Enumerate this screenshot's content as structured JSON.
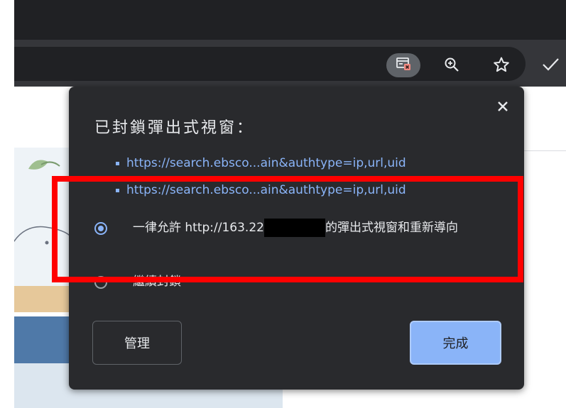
{
  "dialog": {
    "title": "已封鎖彈出式視窗：",
    "blocked_links": [
      "https://search.ebsco...ain&authtype=ip,url,uid",
      "https://search.ebsco...ain&authtype=ip,url,uid"
    ],
    "options": [
      {
        "label_prefix": "一律允許 http://163.22",
        "label_suffix": "的彈出式視窗和重新導向",
        "selected": true
      },
      {
        "label": "繼續封鎖",
        "selected": false
      }
    ],
    "manage_label": "管理",
    "done_label": "完成"
  },
  "colors": {
    "accent": "#8ab4f8",
    "dialog_bg": "#292a2d",
    "highlight": "#ff0000"
  },
  "icons": {
    "toolbar": [
      "popup-blocked-icon",
      "zoom-icon",
      "bookmark-star-icon",
      "checkmark-icon"
    ],
    "dialog": [
      "close-icon"
    ]
  }
}
